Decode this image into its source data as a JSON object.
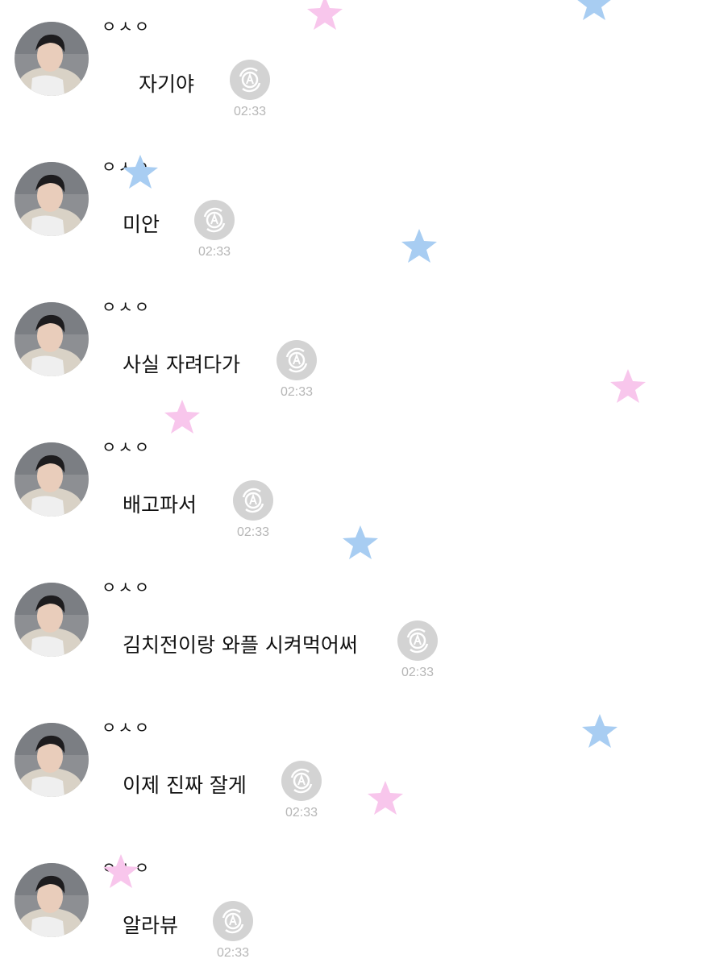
{
  "chat": {
    "messages": [
      {
        "sender": "ㅇㅅㅇ",
        "text": "자기야",
        "time": "02:33"
      },
      {
        "sender": "ㅇㅅㅇ",
        "text": "미안",
        "time": "02:33"
      },
      {
        "sender": "ㅇㅅㅇ",
        "text": "사실 자려다가",
        "time": "02:33"
      },
      {
        "sender": "ㅇㅅㅇ",
        "text": "배고파서",
        "time": "02:33"
      },
      {
        "sender": "ㅇㅅㅇ",
        "text": "김치전이랑 와플 시켜먹어써",
        "time": "02:33"
      },
      {
        "sender": "ㅇㅅㅇ",
        "text": "이제 진짜 잘게",
        "time": "02:33"
      },
      {
        "sender": "ㅇㅅㅇ",
        "text": "알라뷰",
        "time": "02:33"
      }
    ]
  },
  "colors": {
    "star_pink": "#f8c6ec",
    "star_blue": "#a8cdf2",
    "read_icon": "#d3d3d3",
    "time_text": "#b6b6b6"
  },
  "icons": {
    "read_receipt": "translate-icon",
    "avatar": "profile-photo"
  }
}
